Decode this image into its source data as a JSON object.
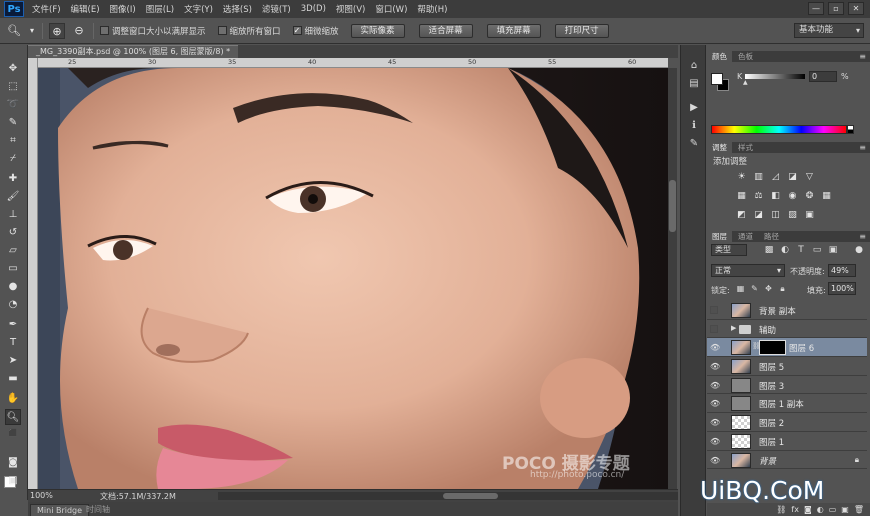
{
  "app": {
    "logo": "Ps"
  },
  "menu": [
    "文件(F)",
    "编辑(E)",
    "图像(I)",
    "图层(L)",
    "文字(Y)",
    "选择(S)",
    "滤镜(T)",
    "3D(D)",
    "视图(V)",
    "窗口(W)",
    "帮助(H)"
  ],
  "window_controls": {
    "minimize": "—",
    "restore": "▫",
    "close": "✕"
  },
  "options": {
    "resize_windows": "调整窗口大小以满屏显示",
    "zoom_all": "缩放所有窗口",
    "scrubby_zoom": "细微缩放",
    "scrubby_checked": true,
    "btn_actual": "实际像素",
    "btn_fit": "适合屏幕",
    "btn_fill": "填充屏幕",
    "btn_print": "打印尺寸",
    "workspace": "基本功能"
  },
  "document": {
    "tab_title": "_MG_3390副本.psd @ 100% (图层 6, 图层蒙版/8) *",
    "ruler_labels": [
      "25",
      "30",
      "35",
      "40",
      "45",
      "50",
      "55",
      "60"
    ]
  },
  "status": {
    "zoom": "100%",
    "doc_info": "文档:57.1M/337.2M"
  },
  "bottom_tabs": {
    "mini_bridge": "Mini Bridge",
    "timeline": "时间轴"
  },
  "color_panel": {
    "tab1": "颜色",
    "tab2": "色板",
    "channel": "K",
    "value": "0",
    "unit": "%"
  },
  "adjust_panel": {
    "tab1": "调整",
    "tab2": "样式",
    "title": "添加调整"
  },
  "layers_panel": {
    "tab1": "图层",
    "tab2": "通道",
    "tab3": "路径",
    "filter": "类型",
    "blend_mode": "正常",
    "opacity_label": "不透明度:",
    "opacity": "49%",
    "lock_label": "锁定:",
    "fill_label": "填充:",
    "fill": "100%",
    "layers": [
      {
        "name": "背景 副本",
        "visible": false,
        "thumb": "photo"
      },
      {
        "name": "辅助",
        "visible": false,
        "thumb": "folder"
      },
      {
        "name": "图层 6",
        "visible": true,
        "thumb": "photo",
        "mask": true,
        "selected": true
      },
      {
        "name": "图层 5",
        "visible": true,
        "thumb": "photo"
      },
      {
        "name": "图层 3",
        "visible": true,
        "thumb": "gray"
      },
      {
        "name": "图层 1 副本",
        "visible": true,
        "thumb": "gray"
      },
      {
        "name": "图层 2",
        "visible": true,
        "thumb": "checker"
      },
      {
        "name": "图层 1",
        "visible": true,
        "thumb": "checker"
      },
      {
        "name": "背景",
        "visible": true,
        "thumb": "photo",
        "locked": true
      }
    ]
  },
  "watermarks": {
    "poco": "POCO 摄影专题",
    "url": "http://photo.poco.cn/",
    "uibq": "UiBQ.CoM"
  }
}
